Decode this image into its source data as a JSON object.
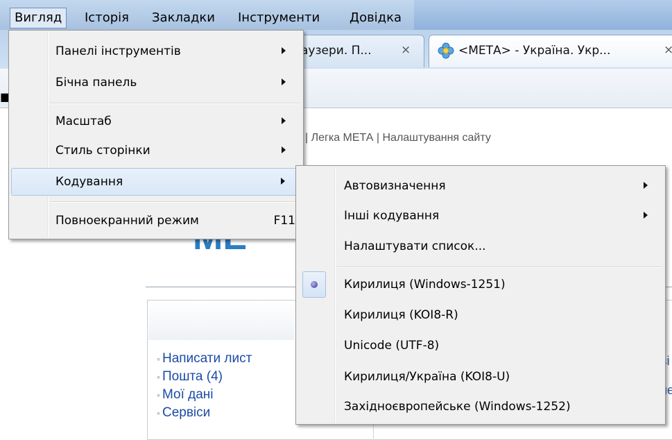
{
  "menubar": {
    "items": [
      {
        "label": "Вигляд",
        "active": true
      },
      {
        "label": "Історія"
      },
      {
        "label": "Закладки"
      },
      {
        "label": "Інструменти"
      },
      {
        "label": "Довідка"
      }
    ]
  },
  "tabs": [
    {
      "title": "аузери. П...",
      "close": "×"
    },
    {
      "title": "<МЕТА> - Україна. Укр...",
      "close": "×",
      "icon": "flower-icon"
    }
  ],
  "page": {
    "top_links": "| Легка МЕТА | Налаштування сайту",
    "logo_fragment": "МЕ",
    "content_links": [
      "Написати лист",
      "Пошта (4)",
      "Мої дані",
      "Сервіси"
    ],
    "right_frag1": "ві",
    "right_frag2": "не"
  },
  "view_menu": {
    "items": [
      {
        "label": "Панелі інструментів",
        "submenu": true
      },
      {
        "label": "Бічна панель",
        "submenu": true
      },
      {
        "label": "Масштаб",
        "submenu": true
      },
      {
        "label": "Стиль сторінки",
        "submenu": true
      },
      {
        "label": "Кодування",
        "submenu": true,
        "highlighted": true
      },
      {
        "label": "Повноекранний режим",
        "accel": "F11"
      }
    ]
  },
  "encoding_menu": {
    "items": [
      {
        "label": "Автовизначення",
        "submenu": true
      },
      {
        "label": "Інші кодування",
        "submenu": true
      },
      {
        "label": "Налаштувати список..."
      },
      {
        "label": "Кирилиця (Windows-1251)",
        "checked": true
      },
      {
        "label": "Кирилиця (KOI8-R)"
      },
      {
        "label": "Unicode (UTF-8)"
      },
      {
        "label": "Кирилиця/Україна (KOI8-U)"
      },
      {
        "label": "Західноєвропейське (Windows-1252)"
      }
    ]
  },
  "colors": {
    "menubar": "#b6cfea",
    "highlight_border": "#a9c3e3",
    "radio": "#3c3196",
    "link": "#1a4aa6"
  }
}
